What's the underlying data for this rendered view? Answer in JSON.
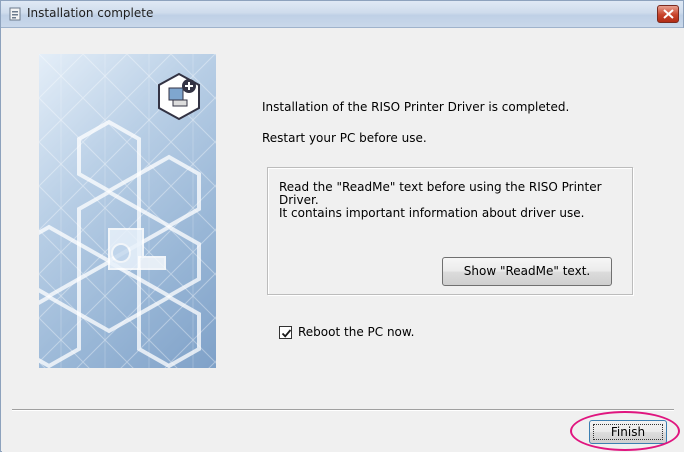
{
  "window": {
    "title": "Installation complete",
    "title_icon": "installer-icon",
    "close_icon": "close-icon"
  },
  "main": {
    "message_completed": "Installation of the RISO Printer Driver is completed.",
    "message_restart": "Restart your PC before use.",
    "readme_group": {
      "line1": "Read the \"ReadMe\" text before using the RISO Printer",
      "line2": "Driver.",
      "line3": "It contains important information about driver use.",
      "button_label": "Show \"ReadMe\" text."
    },
    "reboot_checkbox": {
      "label": "Reboot the PC now.",
      "checked": true
    }
  },
  "footer": {
    "finish_label": "Finish"
  },
  "colors": {
    "highlight": "#e0157f",
    "title_bar": "#cfdcec",
    "close_button": "#c8432b",
    "banner": "#98b6d6"
  }
}
